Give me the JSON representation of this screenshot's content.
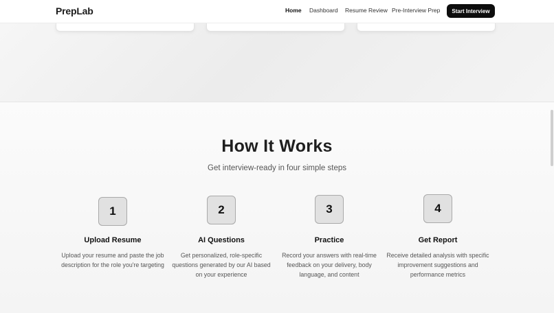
{
  "nav": {
    "logo": "PrepLab",
    "links": [
      {
        "label": "Home",
        "active": true
      },
      {
        "label": "Dashboard",
        "active": false
      },
      {
        "label": "Resume Review",
        "active": false
      },
      {
        "label": "Pre-Interview Prep",
        "active": false
      }
    ],
    "cta": "Start Interview"
  },
  "how_it_works": {
    "title": "How It Works",
    "subtitle": "Get interview-ready in four simple steps",
    "steps": [
      {
        "number": "1",
        "title": "Upload Resume",
        "description": "Upload your resume and paste the job description for the role you're targeting"
      },
      {
        "number": "2",
        "title": "AI Questions",
        "description": "Get personalized, role-specific questions generated by our AI based on your experience"
      },
      {
        "number": "3",
        "title": "Practice",
        "description": "Record your answers with real-time feedback on your delivery, body language, and content"
      },
      {
        "number": "4",
        "title": "Get Report",
        "description": "Receive detailed analysis with specific improvement suggestions and performance metrics"
      }
    ]
  }
}
